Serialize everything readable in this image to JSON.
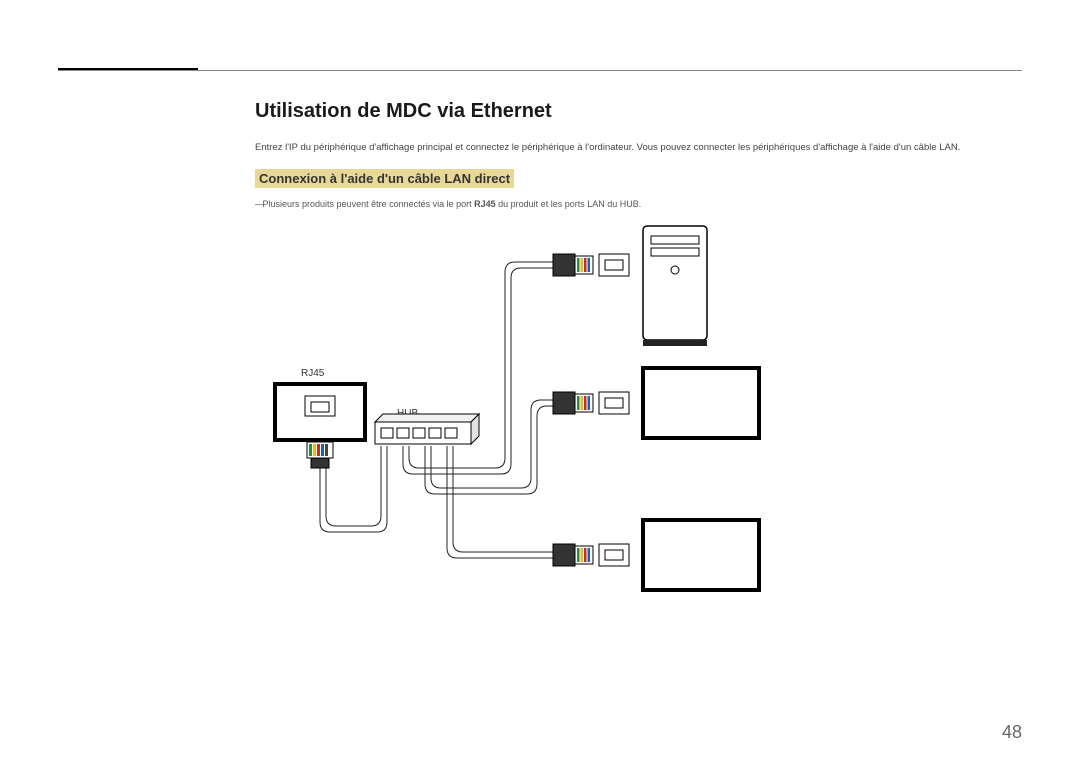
{
  "page": {
    "number": "48"
  },
  "heading": "Utilisation de MDC via Ethernet",
  "intro": "Entrez l'IP du périphérique d'affichage principal et connectez le périphérique à l'ordinateur. Vous pouvez connecter les périphériques d'affichage à l'aide d'un câble LAN.",
  "subheading": "Connexion à l'aide d'un câble LAN direct",
  "note_pre": "Plusieurs produits peuvent être connectés via le port ",
  "note_bold": "RJ45",
  "note_post": " du produit et les ports LAN du HUB.",
  "labels": {
    "rj45": "RJ45",
    "hub": "HUB"
  }
}
